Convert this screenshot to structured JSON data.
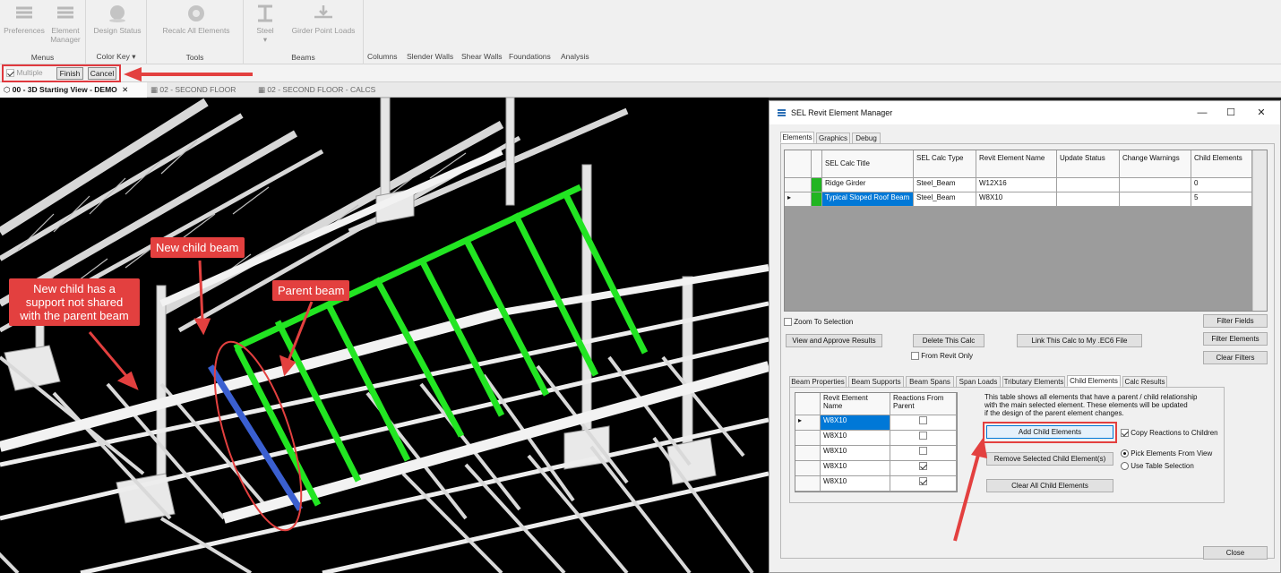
{
  "ribbon": {
    "buttons": {
      "preferences": "Preferences",
      "element_manager_line1": "Element",
      "element_manager_line2": "Manager",
      "design_status": "Design Status",
      "recalc_all": "Recalc All Elements",
      "steel": "Steel",
      "girder_point_loads": "Girder Point Loads"
    },
    "groups": {
      "menus": "Menus",
      "color_key": "Color Key",
      "tools": "Tools",
      "beams": "Beams"
    },
    "tabs": [
      "Columns",
      "Slender Walls",
      "Shear Walls",
      "Foundations",
      "Analysis"
    ]
  },
  "options_bar": {
    "multiple_label": "Multiple",
    "finish_label": "Finish",
    "cancel_label": "Cancel"
  },
  "view_tabs": [
    {
      "label": "00 - 3D Starting View - DEMO",
      "active": true
    },
    {
      "label": "02 - SECOND FLOOR",
      "active": false
    },
    {
      "label": "02 - SECOND FLOOR - CALCS",
      "active": false
    }
  ],
  "callouts": {
    "new_child": "New child beam",
    "parent": "Parent beam",
    "support": "New child has a support not shared with the parent beam"
  },
  "dialog": {
    "title": "SEL Revit Element Manager",
    "top_tabs": [
      "Elements",
      "Graphics",
      "Debug"
    ],
    "elements_table": {
      "headers": [
        "SEL Calc Title",
        "SEL Calc Type",
        "Revit Element Name",
        "Update Status",
        "Change Warnings",
        "Child Elements"
      ],
      "rows": [
        {
          "title": "Ridge Girder",
          "type": "Steel_Beam",
          "revit": "W12X16",
          "update": "",
          "warnings": "",
          "children": "0"
        },
        {
          "title": "Typical Sloped Roof Beam",
          "type": "Steel_Beam",
          "revit": "W8X10",
          "update": "",
          "warnings": "",
          "children": "5"
        }
      ]
    },
    "zoom_to_selection": "Zoom To Selection",
    "filter_fields": "Filter Fields",
    "filter_elements": "Filter Elements",
    "clear_filters": "Clear Filters",
    "view_approve": "View and Approve Results",
    "delete_calc": "Delete This Calc",
    "from_revit_only": "From Revit Only",
    "link_calc": "Link This Calc to My .EC6 File",
    "sub_tabs": [
      "Beam Properties",
      "Beam Supports",
      "Beam Spans",
      "Span Loads",
      "Tributary Elements",
      "Child Elements",
      "Calc Results"
    ],
    "child_table": {
      "headers": [
        "Revit Element Name",
        "Reactions From Parent"
      ],
      "rows": [
        {
          "name": "W8X10",
          "checked": false
        },
        {
          "name": "W8X10",
          "checked": false
        },
        {
          "name": "W8X10",
          "checked": false
        },
        {
          "name": "W8X10",
          "checked": true
        },
        {
          "name": "W8X10",
          "checked": true
        }
      ]
    },
    "description_line1": "This table shows all elements that have a parent / child relationship",
    "description_line2": "with the main selected element.  These elements will be updated",
    "description_line3": "if the design of the parent element changes.",
    "add_child": "Add Child Elements",
    "copy_reactions": "Copy Reactions to Children",
    "remove_child": "Remove Selected Child Element(s)",
    "pick_elements": "Pick Elements From View",
    "use_table": "Use Table Selection",
    "clear_child": "Clear All Child Elements",
    "close": "Close"
  },
  "colors": {
    "highlight_red": "#e3403f",
    "parent_green": "#22e522",
    "child_blue": "#3a5fd0",
    "selection_blue": "#0078d7"
  }
}
